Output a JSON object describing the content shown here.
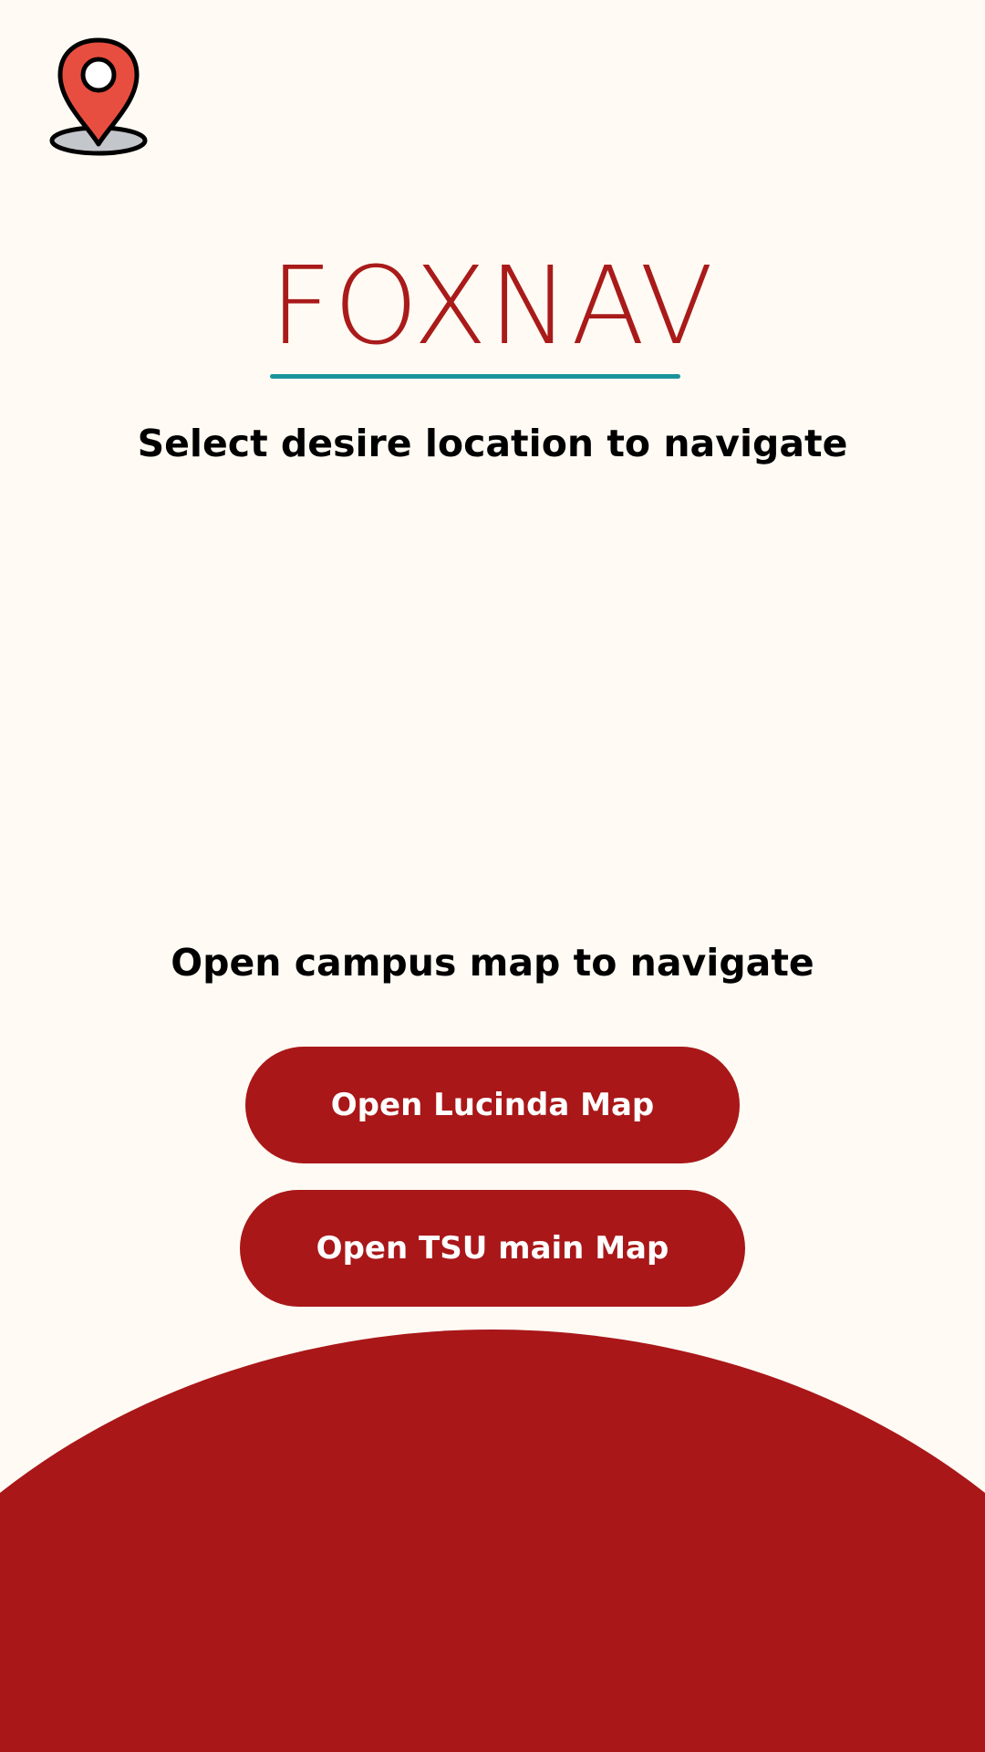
{
  "app": {
    "title": "FOXNAV",
    "subtitle": "Select desire location to navigate",
    "logo_icon": "map-pin-icon"
  },
  "campus_maps": {
    "heading": "Open campus map to navigate",
    "buttons": [
      {
        "label": "Open Lucinda Map"
      },
      {
        "label": "Open TSU main Map"
      }
    ]
  },
  "colors": {
    "background": "#fffbf4",
    "brand_red": "#a91719",
    "accent_teal": "#1a949b",
    "pin_red": "#e84e3f",
    "pin_base_gray": "#c3c6cb"
  }
}
